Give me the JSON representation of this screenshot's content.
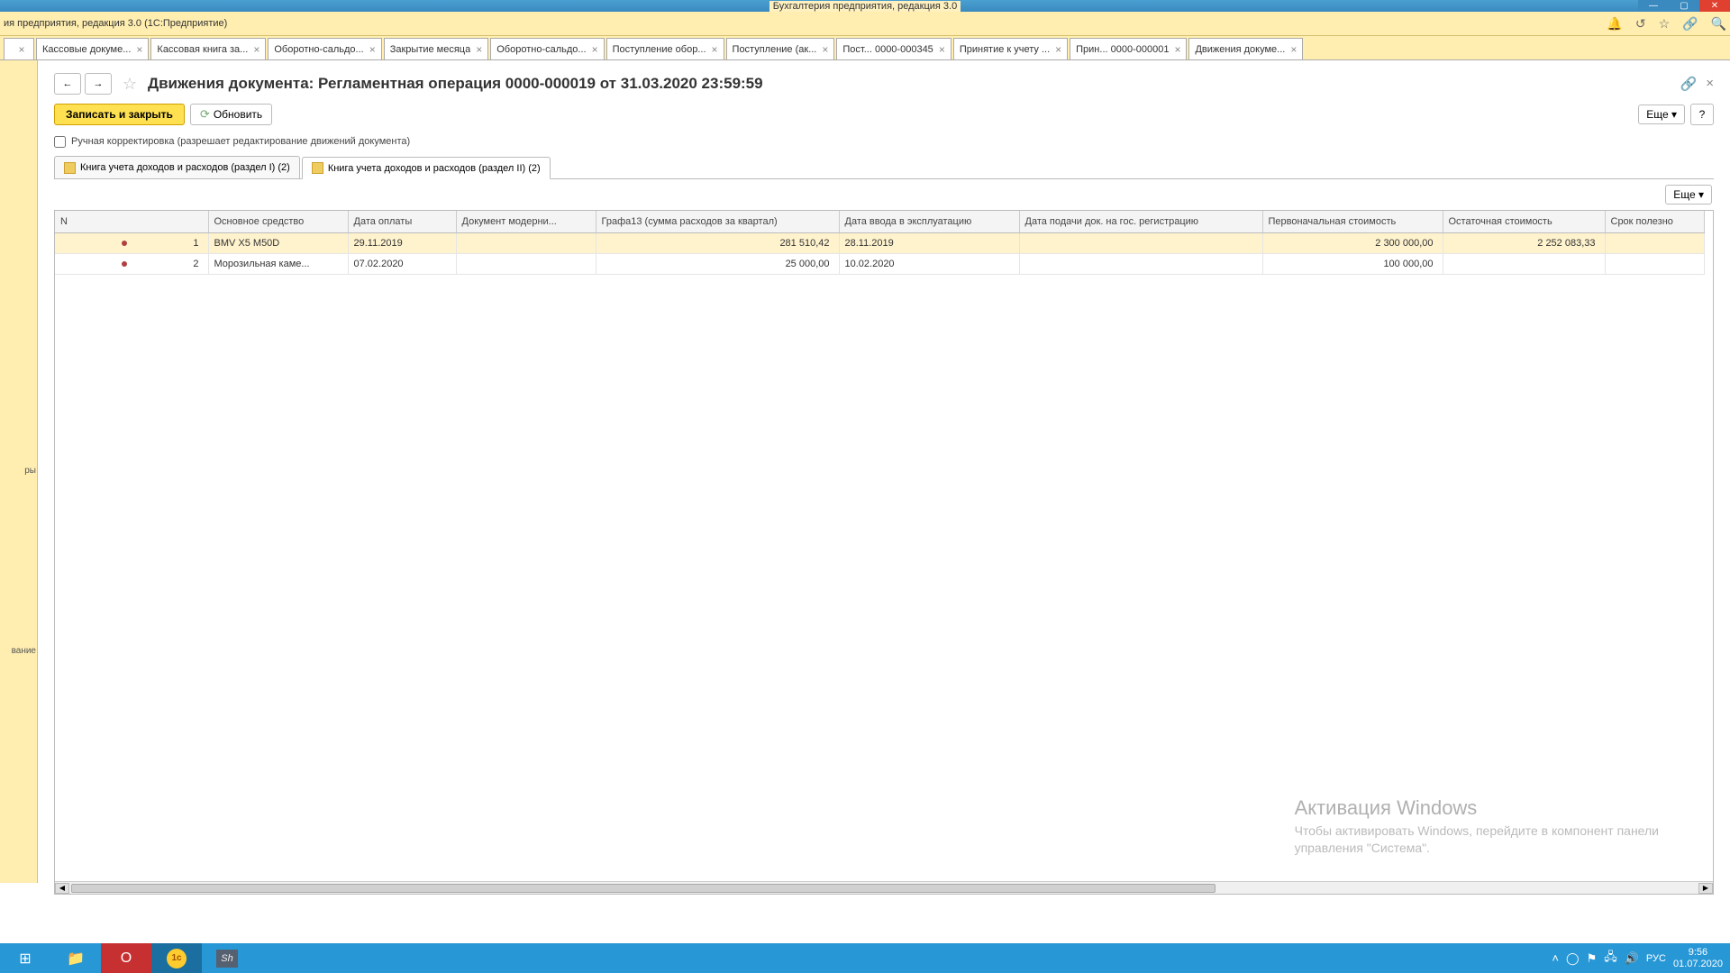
{
  "window": {
    "title": "Бухгалтерия предприятия, редакция 3.0"
  },
  "menubar": {
    "app_name": "ия предприятия, редакция 3.0   (1С:Предприятие)"
  },
  "tabs": [
    {
      "label": "Кассовые докуме..."
    },
    {
      "label": "Кассовая книга за..."
    },
    {
      "label": "Оборотно-сальдо..."
    },
    {
      "label": "Закрытие месяца"
    },
    {
      "label": "Оборотно-сальдо..."
    },
    {
      "label": "Поступление обор..."
    },
    {
      "label": "Поступление (ак..."
    },
    {
      "label": "Пост...   0000-000345"
    },
    {
      "label": "Принятие к учету ..."
    },
    {
      "label": "Прин...  0000-000001"
    },
    {
      "label": "Движения докуме..."
    }
  ],
  "left_stub": {
    "t1": "ры",
    "t2": "вание"
  },
  "doc": {
    "title": "Движения документа: Регламентная операция 0000-000019 от 31.03.2020 23:59:59",
    "save_close": "Записать и закрыть",
    "refresh": "Обновить",
    "more": "Еще",
    "help": "?",
    "manual_label": "Ручная корректировка (разрешает редактирование движений документа)"
  },
  "inner_tabs": [
    "Книга учета доходов и расходов (раздел I) (2)",
    "Книга учета доходов и расходов (раздел II) (2)"
  ],
  "table_more": "Еще",
  "columns": {
    "n": "N",
    "asset": "Основное средство",
    "paydate": "Дата оплаты",
    "moddoc": "Документ модерни...",
    "g13": "Графа13 (сумма расходов за квартал)",
    "expdate": "Дата ввода в эксплуатацию",
    "regdate": "Дата подачи док. на гос. регистрацию",
    "initial": "Первоначальная стоимость",
    "residual": "Остаточная стоимость",
    "useful": "Срок полезно"
  },
  "rows": [
    {
      "n": "1",
      "asset": "BMV X5 M50D",
      "paydate": "29.11.2019",
      "moddoc": "",
      "g13": "281 510,42",
      "expdate": "28.11.2019",
      "regdate": "",
      "initial": "2 300 000,00",
      "residual": "2 252 083,33",
      "useful": ""
    },
    {
      "n": "2",
      "asset": "Морозильная каме...",
      "paydate": "07.02.2020",
      "moddoc": "",
      "g13": "25 000,00",
      "expdate": "10.02.2020",
      "regdate": "",
      "initial": "100 000,00",
      "residual": "",
      "useful": ""
    }
  ],
  "watermark": {
    "title": "Активация Windows",
    "line1": "Чтобы активировать Windows, перейдите в компонент панели",
    "line2": "управления \"Система\"."
  },
  "tray": {
    "lang": "РУС",
    "time": "9:56",
    "date": "01.07.2020"
  }
}
